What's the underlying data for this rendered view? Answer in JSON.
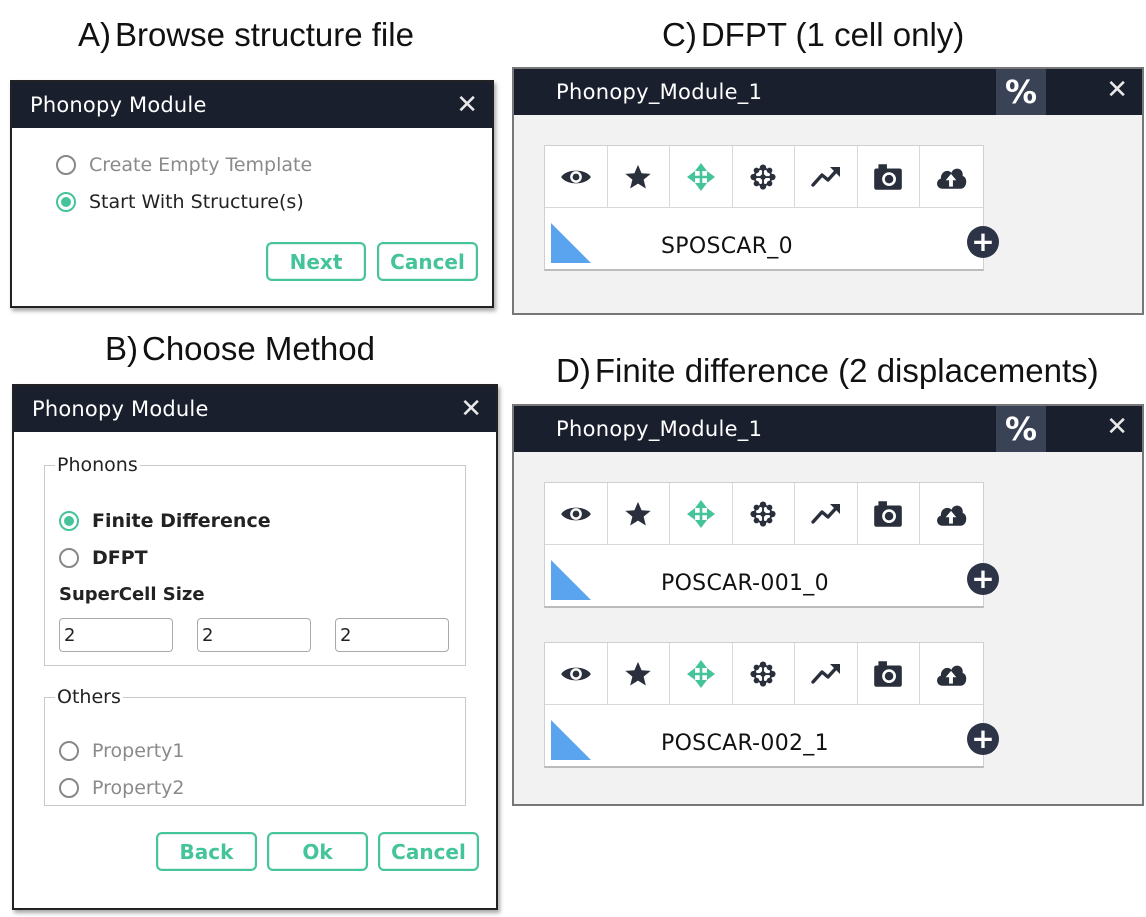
{
  "captions": {
    "a": {
      "letter": "A)",
      "text": "Browse structure file"
    },
    "b": {
      "letter": "B)",
      "text": "Choose Method"
    },
    "c": {
      "letter": "C)",
      "text": "DFPT (1 cell only)"
    },
    "d": {
      "letter": "D)",
      "text": "Finite difference (2 displacements)"
    }
  },
  "dialog_a": {
    "title": "Phonopy Module",
    "close": "✕",
    "options": [
      {
        "label": "Create Empty Template",
        "selected": false
      },
      {
        "label": "Start With Structure(s)",
        "selected": true
      }
    ],
    "next_label": "Next",
    "cancel_label": "Cancel"
  },
  "dialog_b": {
    "title": "Phonopy Module",
    "close": "✕",
    "phonons_legend": "Phonons",
    "methods": [
      {
        "label": "Finite Difference",
        "selected": true
      },
      {
        "label": "DFPT",
        "selected": false
      }
    ],
    "supercell_label": "SuperCell Size",
    "supercell": [
      "2",
      "2",
      "2"
    ],
    "others_legend": "Others",
    "others": [
      {
        "label": "Property1",
        "selected": false
      },
      {
        "label": "Property2",
        "selected": false
      }
    ],
    "back_label": "Back",
    "ok_label": "Ok",
    "cancel_label": "Cancel"
  },
  "module_c": {
    "title": "Phonopy_Module_1",
    "percent": "%",
    "close": "✕",
    "structures": [
      "SPOSCAR_0"
    ]
  },
  "module_d": {
    "title": "Phonopy_Module_1",
    "percent": "%",
    "close": "✕",
    "structures": [
      "POSCAR-001_0",
      "POSCAR-002_1"
    ]
  },
  "toolbar_icons": [
    "eye-icon",
    "star-icon",
    "move-icon",
    "molecule-icon",
    "trend-icon",
    "camera-icon",
    "cloud-upload-icon"
  ],
  "add_symbol": "+",
  "colors": {
    "accent": "#45c49b",
    "header": "#1a1f2e",
    "structure_triangle": "#5aa3ee"
  }
}
